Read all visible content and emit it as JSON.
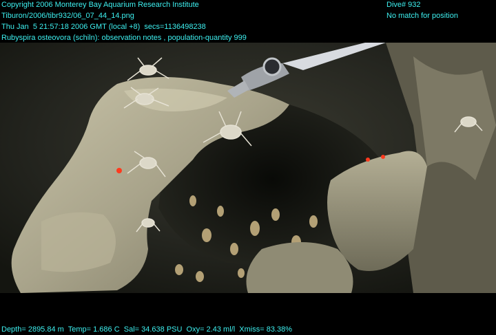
{
  "overlay": {
    "top_left": [
      "Copyright 2006 Monterey Bay Aquarium Research Institute",
      "Tiburon/2006/tibr932/06_07_44_14.png",
      "Thu Jan  5 21:57:18 2006 GMT (local +8)  secs=1136498238",
      "Rubyspira osteovora (schiln): observation notes , population-quantity 999"
    ],
    "top_right": [
      "Dive# 932",
      "No match for position"
    ],
    "bottom": "Depth= 2895.84 m  Temp= 1.686 C  Sal= 34.638 PSU  Oxy= 2.43 ml/l  Xmiss= 83.38%"
  },
  "colors": {
    "overlay_text": "#3ef0f0",
    "background": "#000000",
    "rock": "#a8a48c",
    "sediment": "#2a2c24"
  }
}
